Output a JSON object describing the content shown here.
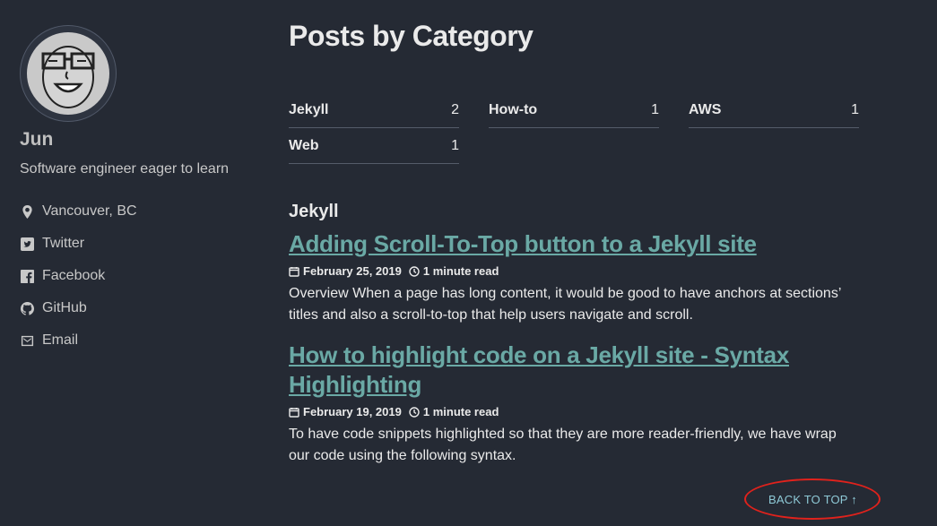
{
  "author": {
    "name": "Jun",
    "bio": "Software engineer eager to learn",
    "links": [
      {
        "label": "Vancouver, BC",
        "icon": "location-pin-icon"
      },
      {
        "label": "Twitter",
        "icon": "twitter-icon"
      },
      {
        "label": "Facebook",
        "icon": "facebook-icon"
      },
      {
        "label": "GitHub",
        "icon": "github-icon"
      },
      {
        "label": "Email",
        "icon": "email-icon"
      }
    ]
  },
  "page": {
    "title": "Posts by Category"
  },
  "categories": [
    {
      "name": "Jekyll",
      "count": "2"
    },
    {
      "name": "How-to",
      "count": "1"
    },
    {
      "name": "AWS",
      "count": "1"
    },
    {
      "name": "Web",
      "count": "1"
    }
  ],
  "section": {
    "title": "Jekyll"
  },
  "posts": [
    {
      "title": "Adding Scroll-To-Top button to a Jekyll site",
      "date": "February 25, 2019",
      "read_time": "1 minute read",
      "excerpt": "Overview When a page has long content, it would be good to have anchors at sections’ titles and also a scroll-to-top that help users navigate and scroll."
    },
    {
      "title": "How to highlight code on a Jekyll site - Syntax Highlighting",
      "date": "February 19, 2019",
      "read_time": "1 minute read",
      "excerpt": "To have code snippets highlighted so that they are more reader-friendly, we have wrap our code using the following syntax."
    }
  ],
  "back_to_top": {
    "label": "BACK TO TOP ↑"
  },
  "colors": {
    "background": "#252a34",
    "link": "#6aa9a5",
    "back_to_top": "#8ec9d6",
    "highlight_ring": "#e0221c"
  }
}
